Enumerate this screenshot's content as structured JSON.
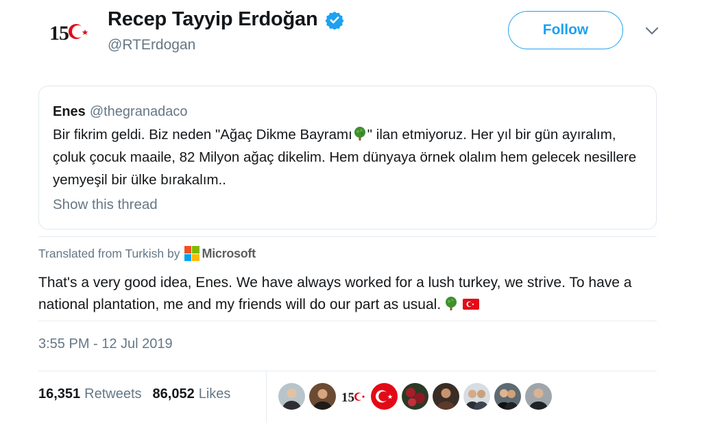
{
  "author": {
    "name": "Recep Tayyip Erdoğan",
    "handle": "@RTErdogan",
    "avatar_icon": "15-temmuz-logo",
    "verified_icon": "verified-badge-icon"
  },
  "follow_label": "Follow",
  "menu_icon": "chevron-down-icon",
  "quoted_tweet": {
    "name": "Enes",
    "handle": "@thegranadaco",
    "text_before_emoji": "Bir fikrim geldi. Biz neden \"Ağaç Dikme Bayramı",
    "text_after_emoji": "\" ilan etmiyoruz. Her yıl bir gün ayıralım, çoluk çocuk maaile, 82 Milyon ağaç dikelim. Hem dünyaya örnek olalım hem gelecek nesillere yemyeşil bir ülke bırakalım..",
    "show_thread": "Show this thread"
  },
  "translation": {
    "label": "Translated from Turkish by",
    "provider": "Microsoft",
    "text": "That's a very good idea, Enes. We have always worked for a lush turkey, we strive. To have a national plantation, me and my friends will do our part as usual."
  },
  "timestamp": "3:55 PM - 12 Jul 2019",
  "stats": {
    "retweets_count": "16,351",
    "retweets_label": "Retweets",
    "likes_count": "86,052",
    "likes_label": "Likes"
  },
  "colors": {
    "accent": "#1da1f2",
    "secondary_text": "#657786",
    "border": "#e1e8ed"
  }
}
